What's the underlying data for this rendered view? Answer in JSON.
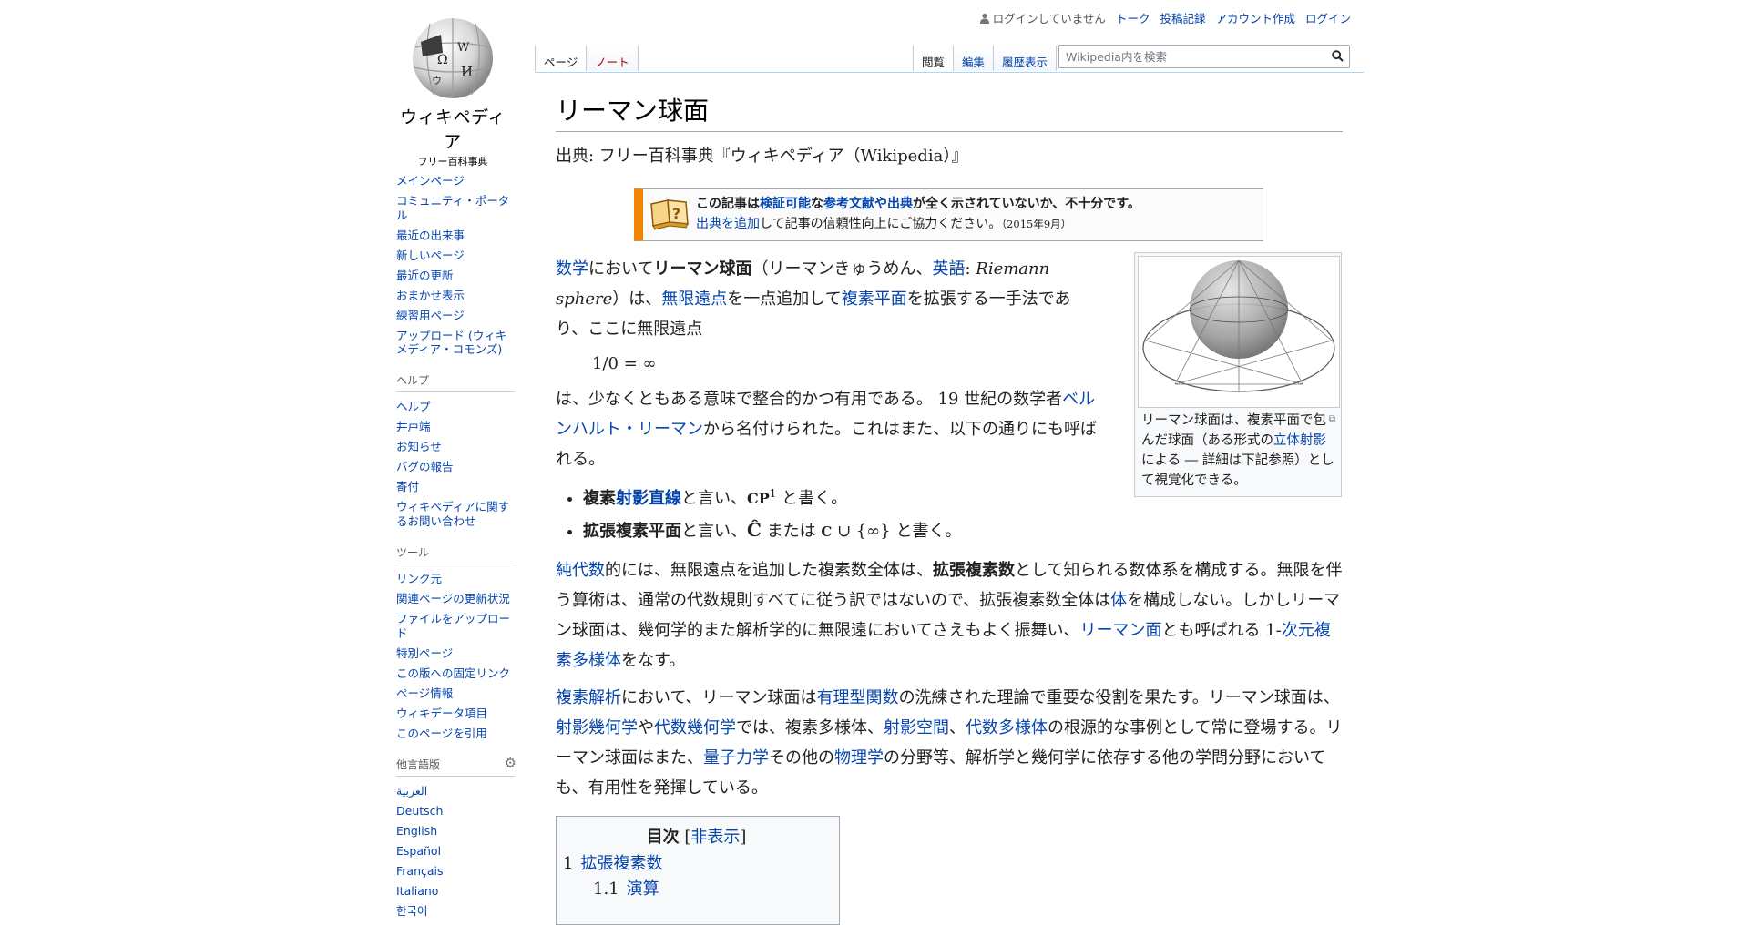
{
  "logo": {
    "wordmark": "ウィキペディア",
    "tagline": "フリー百科事典"
  },
  "sidebar": {
    "nav": [
      "メインページ",
      "コミュニティ・ポータル",
      "最近の出来事",
      "新しいページ",
      "最近の更新",
      "おまかせ表示",
      "練習用ページ",
      "アップロード (ウィキメディア・コモンズ)"
    ],
    "help_heading": "ヘルプ",
    "help": [
      "ヘルプ",
      "井戸端",
      "お知らせ",
      "バグの報告",
      "寄付",
      "ウィキペディアに関するお問い合わせ"
    ],
    "tools_heading": "ツール",
    "tools": [
      "リンク元",
      "関連ページの更新状況",
      "ファイルをアップロード",
      "特別ページ",
      "この版への固定リンク",
      "ページ情報",
      "ウィキデータ項目",
      "このページを引用"
    ],
    "lang_heading": "他言語版",
    "langs": [
      "العربية",
      "Deutsch",
      "English",
      "Español",
      "Français",
      "Italiano",
      "한국어"
    ]
  },
  "personal": {
    "user": "ログインしていません",
    "links": [
      "トーク",
      "投稿記録",
      "アカウント作成",
      "ログイン"
    ]
  },
  "tabs": {
    "left": [
      "ページ",
      "ノート"
    ],
    "right": [
      "閲覧",
      "編集",
      "履歴表示"
    ]
  },
  "search": {
    "placeholder": "Wikipedia内を検索"
  },
  "article": {
    "title": "リーマン球面",
    "site_sub": "出典: フリー百科事典『ウィキペディア（Wikipedia）』",
    "ambox": {
      "l1_a": "この記事は",
      "l1_link1": "検証可能",
      "l1_b": "な",
      "l1_link2": "参考文献や出典",
      "l1_c": "が全く示されていないか、不十分です。",
      "l2_link": "出典を追加",
      "l2_text": "して記事の信頼性向上にご協力ください。",
      "l2_date": "（2015年9月）"
    },
    "intro": {
      "link_math": "数学",
      "t1": "において",
      "bold_title": "リーマン球面",
      "t2": "（リーマンきゅうめん、",
      "link_en": "英語",
      "t3": ": ",
      "italic_en": "Riemann sphere",
      "t4": "）は、",
      "link_inf": "無限遠点",
      "t5": "を一点追加して",
      "link_cplane": "複素平面",
      "t6": "を拡張する一手法であり、ここに無限遠点"
    },
    "math_line": "1/0 = ∞",
    "p2": {
      "t1": "は、少なくともある意味で整合的かつ有用である。 19 世紀の数学者",
      "link": "ベルンハルト・リーマン",
      "t2": "から名付けられた。これはまた、以下の通りにも呼ばれる。"
    },
    "bullets": {
      "b1_bold1": "複素",
      "b1_link": "射影直線",
      "b1_t": "と言い、",
      "b1_cp": "CP",
      "b1_sup": "1",
      "b1_end": " と書く。",
      "b2_bold": "拡張複素平面",
      "b2_t": "と言い、",
      "b2_chat": "Ĉ",
      "b2_mid": " または ",
      "b2_c": "C",
      "b2_end": " ∪ {∞} と書く。"
    },
    "p3": {
      "link1": "純代数",
      "t1": "的には、無限遠点を追加した複素数全体は、",
      "bold": "拡張複素数",
      "t2": "として知られる数体系を構成する。無限を伴う算術は、通常の代数規則すべてに従う訳ではないので、拡張複素数全体は",
      "link2": "体",
      "t3": "を構成しない。しかしリーマン球面は、幾何学的また解析学的に無限遠においてさえもよく振舞い、",
      "link3": "リーマン面",
      "t4": "とも呼ばれる 1-",
      "link4": "次元複素多様体",
      "t5": "をなす。"
    },
    "p4": {
      "link1": "複素解析",
      "t1": "において、リーマン球面は",
      "link2": "有理型関数",
      "t2": "の洗練された理論で重要な役割を果たす。リーマン球面は、",
      "link3": "射影幾何学",
      "t3": "や",
      "link4": "代数幾何学",
      "t4": "では、複素多様体、",
      "link5": "射影空間",
      "t5": "、",
      "link6": "代数多様体",
      "t6": "の根源的な事例として常に登場する。リーマン球面はまた、",
      "link7": "量子力学",
      "t7": "その他の",
      "link8": "物理学",
      "t8": "の分野等、解析学と幾何学に依存する他の学問分野においても、有用性を発揮している。"
    },
    "thumb": {
      "c1": "リーマン球面は、複素平面で包んだ球面（ある形式の",
      "link": "立体射影",
      "c2": "による ― 詳細は下記参照）として視覚化できる。"
    },
    "toc": {
      "title": "目次",
      "toggle_open": "[",
      "toggle": "非表示",
      "toggle_close": "]",
      "items": [
        {
          "num": "1",
          "label": "拡張複素数"
        },
        {
          "num": "1.1",
          "label": "演算"
        }
      ]
    }
  }
}
